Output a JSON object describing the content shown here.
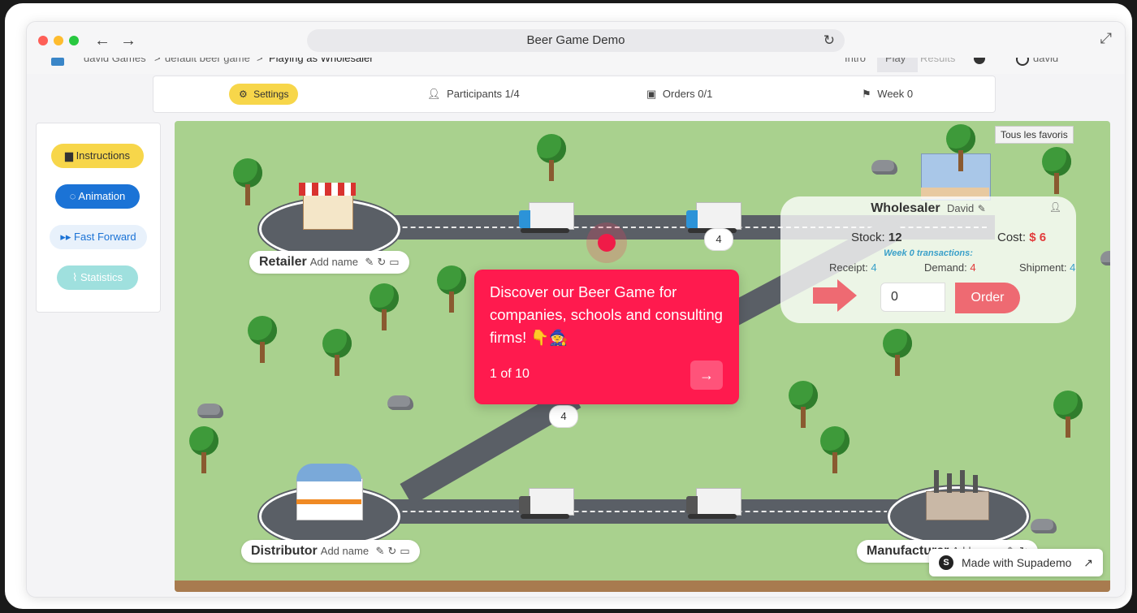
{
  "browser": {
    "title": "Beer Game Demo",
    "back_icon": "←",
    "forward_icon": "→",
    "reload_icon": "↻",
    "expand_icon": "⤢"
  },
  "app_nav": {
    "crumb_games": "david Games",
    "crumb_game": "default beer game",
    "crumb_playing": "Playing as Wholesaler",
    "sep": ">",
    "tab_intro": "Intro",
    "tab_play": "Play",
    "tab_results": "Results",
    "user": "david"
  },
  "topbar": {
    "settings": "Settings",
    "participants": "Participants 1/4",
    "orders": "Orders 0/1",
    "week": "Week 0"
  },
  "sidebar": {
    "instructions": "Instructions",
    "animation": "Animation",
    "fast_forward": "Fast Forward",
    "statistics": "Statistics"
  },
  "stations": {
    "retailer": {
      "name": "Retailer",
      "add": "Add name"
    },
    "distributor": {
      "name": "Distributor",
      "add": "Add name"
    },
    "manufacturer": {
      "name": "Manufacturer",
      "add": "Add name"
    }
  },
  "bubbles": {
    "top": "4",
    "mid": "4"
  },
  "wholesaler": {
    "title": "Wholesaler",
    "player": "David",
    "stock_label": "Stock:",
    "stock_value": "12",
    "cost_label": "Cost:",
    "cost_value": "$ 6",
    "transactions_title": "Week 0 transactions:",
    "receipt_label": "Receipt:",
    "receipt_value": "4",
    "demand_label": "Demand:",
    "demand_value": "4",
    "shipment_label": "Shipment:",
    "shipment_value": "4",
    "order_input_value": "0",
    "order_button": "Order"
  },
  "tooltip": {
    "text": "Discover our Beer Game for companies, schools and consulting firms! 👇🧙",
    "step": "1 of 10",
    "next_icon": "→"
  },
  "favorites_tag": "Tous les favoris",
  "supademo": {
    "label": "Made with Supademo",
    "logo": "S",
    "arrow": "↗"
  },
  "colors": {
    "accent_red": "#ff1a4e",
    "cost_red": "#e23b3b",
    "receipt_blue": "#3aa0c9",
    "order_button": "#ee6a72",
    "settings_yellow": "#f7d64a",
    "grass": "#a9d18e",
    "road": "#5a5f66"
  }
}
